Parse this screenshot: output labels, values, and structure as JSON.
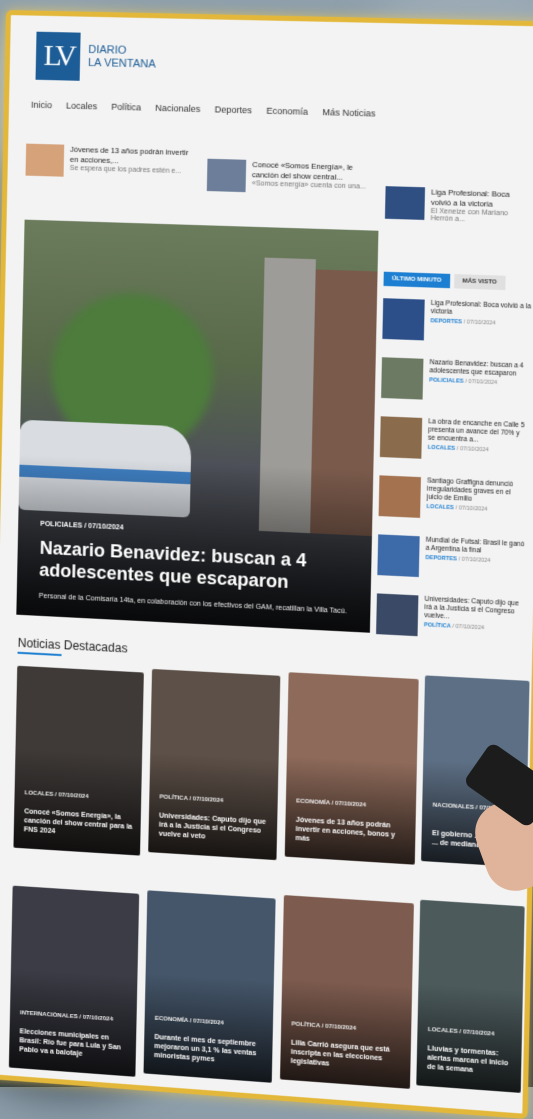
{
  "brand": {
    "logo": "LV",
    "name_line1": "DIARIO",
    "name_line2": "LA VENTANA"
  },
  "nav": [
    "Inicio",
    "Locales",
    "Política",
    "Nacionales",
    "Deportes",
    "Economía",
    "Más Noticias"
  ],
  "ticker": [
    {
      "title": "Jóvenes de 13 años podrán invertir en acciones,...",
      "sub": "Se espera que los padres estén e..."
    },
    {
      "title": "Conocé «Somos Energía», le canción del show central...",
      "sub": "«Somos energía» cuenta con una..."
    },
    {
      "title": "Liga Profesional: Boca volvió a la victoria",
      "sub": "El Xeneize con Mariano Herrón a..."
    }
  ],
  "hero": {
    "category": "POLICIALES",
    "date": "07/10/2024",
    "title": "Nazario Benavidez: buscan a 4 adolescentes que escaparon",
    "summary": "Personal de la Comisaría 14ta, en colaboración con los efectivos del GAM, recatillan la Villa Tacú."
  },
  "sidebar": {
    "tabs": [
      "ÚLTIMO MINUTO",
      "MÁS VISTO"
    ],
    "items": [
      {
        "title": "Liga Profesional: Boca volvió a la victoria",
        "cat": "DEPORTES",
        "date": "07/10/2024"
      },
      {
        "title": "Nazario Benavidez: buscan a 4 adolescentes que escaparon",
        "cat": "POLICIALES",
        "date": "07/10/2024"
      },
      {
        "title": "La obra de encanche en Calle 5 presenta un avance del 70% y se encuentra a...",
        "cat": "LOCALES",
        "date": "07/10/2024"
      },
      {
        "title": "Santiago Graffigna denunció irregularidades graves en el juicio de Emilio",
        "cat": "LOCALES",
        "date": "07/10/2024"
      },
      {
        "title": "Mundial de Futsal: Brasil le ganó a Argentina la final",
        "cat": "DEPORTES",
        "date": "07/10/2024"
      },
      {
        "title": "Universidades: Caputo dijo que irá a la Justicia si el Congreso vuelve...",
        "cat": "POLÍTICA",
        "date": "07/10/2024"
      }
    ]
  },
  "destacadas": {
    "title": "Noticias Destacadas",
    "cards": [
      {
        "cat": "LOCALES",
        "date": "07/10/2024",
        "title": "Conocé «Somos Energía», la canción del show central para la FNS 2024"
      },
      {
        "cat": "POLÍTICA",
        "date": "07/10/2024",
        "title": "Universidades: Caputo dijo que irá a la Justicia si el Congreso vuelve al veto"
      },
      {
        "cat": "ECONOMÍA",
        "date": "07/10/2024",
        "title": "Jóvenes de 13 años podrán invertir en acciones, bonos y más"
      },
      {
        "cat": "NACIONALES",
        "date": "07/10/2024",
        "title": "El gobierno ... desregula ... de medianas y ..."
      },
      {
        "cat": "INTERNACIONALES",
        "date": "07/10/2024",
        "title": "Elecciones municipales en Brasil: Río fue para Lula y San Pablo va a balotaje"
      },
      {
        "cat": "ECONOMÍA",
        "date": "07/10/2024",
        "title": "Durante el mes de septiembre mejoraron un 3,1 % las ventas minoristas pymes"
      },
      {
        "cat": "POLÍTICA",
        "date": "07/10/2024",
        "title": "Lilia Carrió asegura que está inscripta en las elecciones legislativas"
      },
      {
        "cat": "LOCALES",
        "date": "07/10/2024",
        "title": "Lluvias y tormentas: alertas marcan el inicio de la semana"
      }
    ]
  }
}
